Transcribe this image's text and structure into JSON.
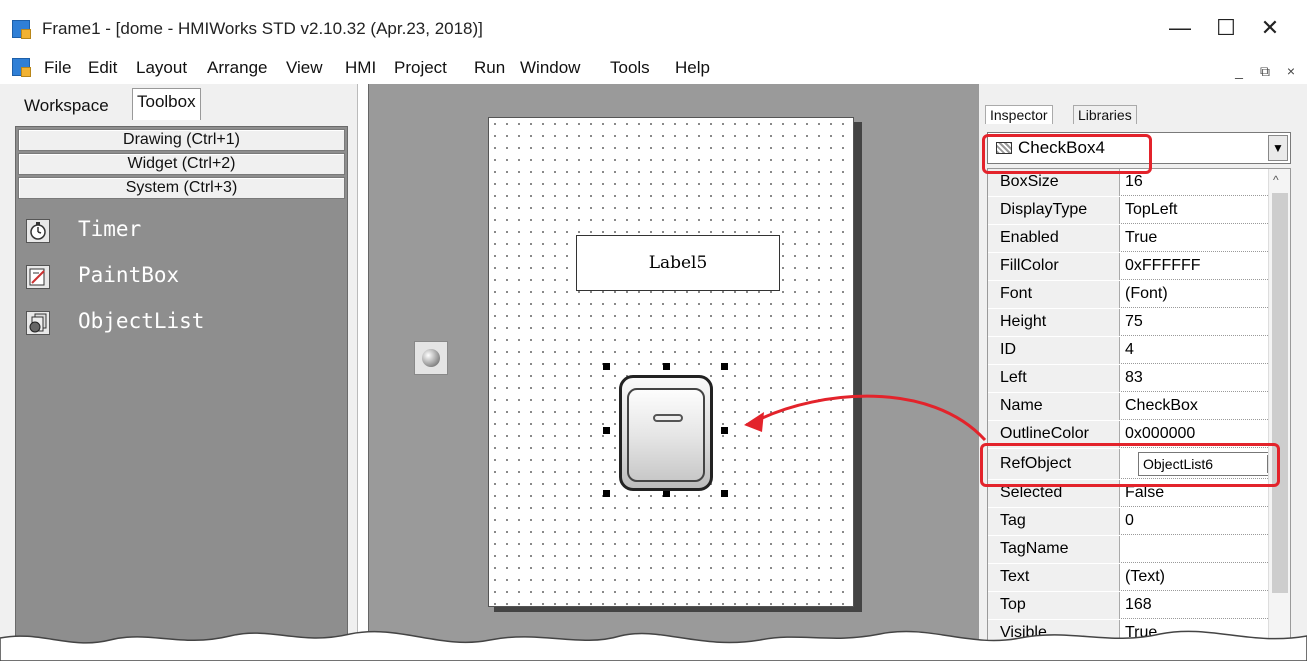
{
  "window": {
    "title": "Frame1 - [dome - HMIWorks STD v2.10.32 (Apr.23, 2018)]",
    "minimize": "—",
    "maximize": "☐",
    "close": "✕"
  },
  "menu": {
    "items": [
      "File",
      "Edit",
      "Layout",
      "Arrange",
      "View",
      "HMI",
      "Project",
      "Run",
      "Window",
      "Tools",
      "Help"
    ],
    "mdi_minimize": "_",
    "mdi_restore": "⧉",
    "mdi_close": "×"
  },
  "left_panel": {
    "tabs": [
      "Workspace",
      "Toolbox"
    ],
    "active_tab": "Toolbox",
    "categories": [
      "Drawing (Ctrl+1)",
      "Widget (Ctrl+2)",
      "System (Ctrl+3)"
    ],
    "tools": [
      {
        "label": "Timer",
        "icon": "timer-icon"
      },
      {
        "label": "PaintBox",
        "icon": "paintbox-icon"
      },
      {
        "label": "ObjectList",
        "icon": "objectlist-icon"
      }
    ]
  },
  "canvas": {
    "label_text": "Label5",
    "objects": [
      "Label5",
      "CheckBox switch"
    ]
  },
  "right_panel": {
    "tabs": [
      "Inspector",
      "Libraries"
    ],
    "active_tab": "Inspector",
    "selected_object": "CheckBox4",
    "properties": [
      {
        "name": "BoxSize",
        "value": "16"
      },
      {
        "name": "DisplayType",
        "value": "TopLeft"
      },
      {
        "name": "Enabled",
        "value": "True"
      },
      {
        "name": "FillColor",
        "value": "0xFFFFFF"
      },
      {
        "name": "Font",
        "value": "(Font)"
      },
      {
        "name": "Height",
        "value": "75"
      },
      {
        "name": "ID",
        "value": "4"
      },
      {
        "name": "Left",
        "value": "83"
      },
      {
        "name": "Name",
        "value": "CheckBox"
      },
      {
        "name": "OutlineColor",
        "value": "0x000000"
      },
      {
        "name": "RefObject",
        "value": "ObjectList6"
      },
      {
        "name": "Selected",
        "value": "False"
      },
      {
        "name": "Tag",
        "value": "0"
      },
      {
        "name": "TagName",
        "value": ""
      },
      {
        "name": "Text",
        "value": "(Text)"
      },
      {
        "name": "Top",
        "value": "168"
      },
      {
        "name": "Visible",
        "value": "True"
      }
    ]
  },
  "colors": {
    "highlight": "#e3232b",
    "toolbox_bg": "#8e8e8e",
    "design_bg": "#9a9a9a"
  }
}
